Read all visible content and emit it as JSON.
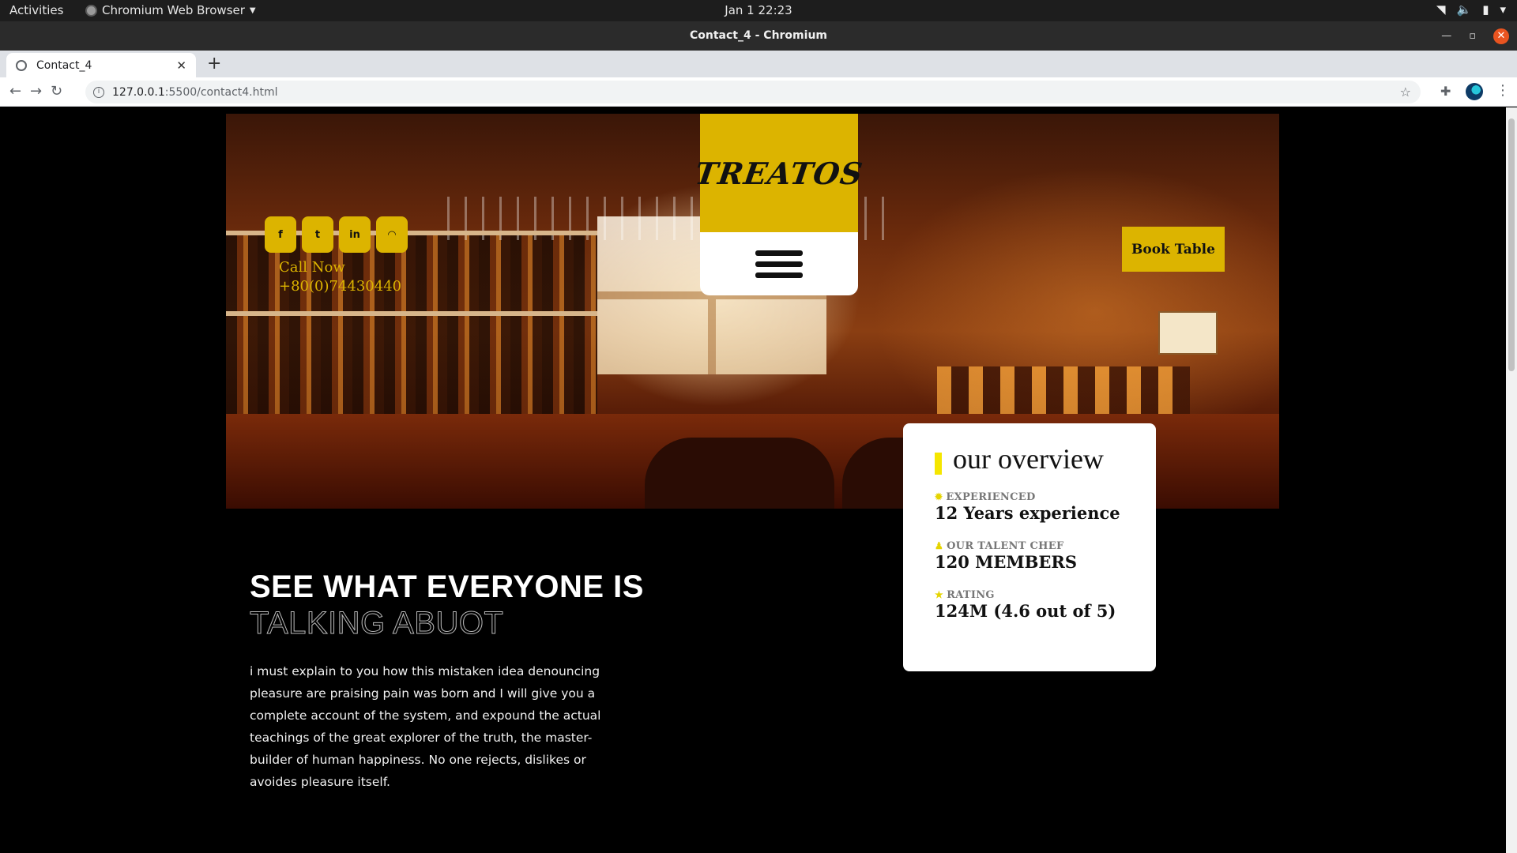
{
  "os": {
    "activities": "Activities",
    "app_name": "Chromium Web Browser",
    "clock": "Jan 1  22:23"
  },
  "window": {
    "title": "Contact_4 - Chromium"
  },
  "browser": {
    "tab_title": "Contact_4",
    "url_host": "127.0.0.1",
    "url_path": ":5500/contact4.html"
  },
  "page": {
    "logo": "TREATOS",
    "social": [
      "f",
      "t",
      "in",
      "◠"
    ],
    "call_label": "Call Now",
    "call_number": "+80(0)74430440",
    "book_button": "Book Table",
    "overview": {
      "title": "our overview",
      "items": [
        {
          "label": "EXPERIENCED",
          "value": "12 Years experience",
          "icon": "gear-icon"
        },
        {
          "label": "OUR TALENT CHEF",
          "value": "120 MEMBERS",
          "icon": "person-icon"
        },
        {
          "label": "RATING",
          "value": "124M (4.6 out of 5)",
          "icon": "star-icon"
        }
      ]
    },
    "testimonial": {
      "heading_line1": "SEE WHAT EVERYONE IS",
      "heading_line2": "TALKING ABUOT",
      "body": "i must explain to you how this mistaken idea denouncing pleasure are praising pain was born and I will give you a complete account of the system, and expound the actual teachings of the great explorer of the truth, the master-builder of human happiness. No one rejects, dislikes or avoides pleasure itself."
    }
  },
  "colors": {
    "accent_yellow": "#dcb400",
    "overview_marker": "#f5e600",
    "page_bg": "#000000"
  }
}
